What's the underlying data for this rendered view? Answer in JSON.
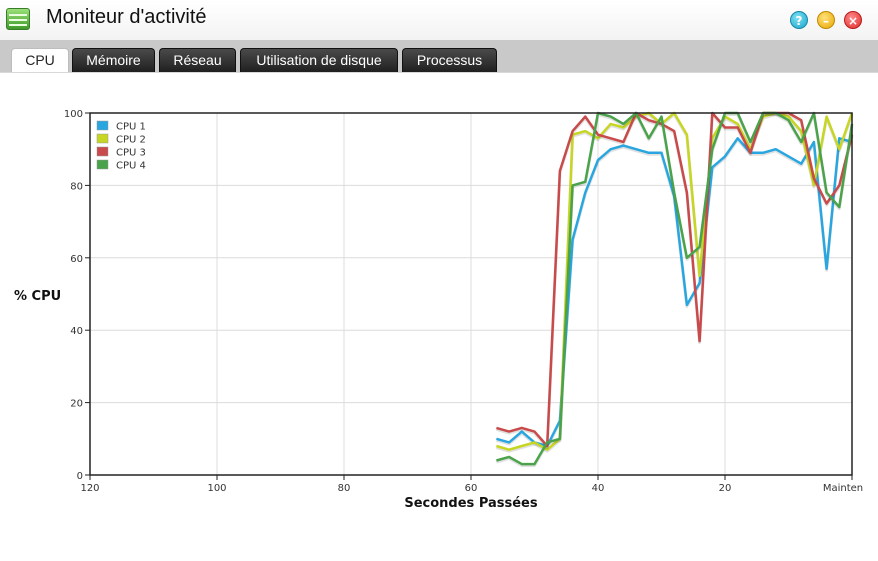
{
  "window": {
    "title": "Moniteur d'activité",
    "help_glyph": "?",
    "min_glyph": "–",
    "close_glyph": "×"
  },
  "tabs": [
    {
      "label": "CPU",
      "active": true
    },
    {
      "label": "Mémoire",
      "active": false
    },
    {
      "label": "Réseau",
      "active": false
    },
    {
      "label": "Utilisation de disque",
      "active": false
    },
    {
      "label": "Processus",
      "active": false
    }
  ],
  "colors": {
    "cpu1": "#29a6e0",
    "cpu2": "#c6d623",
    "cpu3": "#c84a4a",
    "cpu4": "#4aa34a",
    "grid": "#dcdcdc",
    "tab_dark": "#2a2a2a"
  },
  "chart_data": {
    "type": "line",
    "ylabel": "% CPU",
    "xlabel": "Secondes Passées",
    "xlim": [
      120,
      0
    ],
    "ylim": [
      0,
      100
    ],
    "x_ticks": [
      {
        "value": 120,
        "label": "120"
      },
      {
        "value": 100,
        "label": "100"
      },
      {
        "value": 80,
        "label": "80"
      },
      {
        "value": 60,
        "label": "60"
      },
      {
        "value": 40,
        "label": "40"
      },
      {
        "value": 20,
        "label": "20"
      },
      {
        "value": 0,
        "label": "Mainten"
      }
    ],
    "y_ticks": [
      {
        "value": 0,
        "label": "0"
      },
      {
        "value": 20,
        "label": "20"
      },
      {
        "value": 40,
        "label": "40"
      },
      {
        "value": 60,
        "label": "60"
      },
      {
        "value": 80,
        "label": "80"
      },
      {
        "value": 100,
        "label": "100"
      }
    ],
    "grid": true,
    "legend": "top-left",
    "x": [
      56,
      54,
      52,
      50,
      48,
      46,
      44,
      42,
      40,
      38,
      36,
      34,
      32,
      30,
      28,
      26,
      24,
      22,
      20,
      18,
      16,
      14,
      12,
      10,
      8,
      6,
      4,
      2,
      0
    ],
    "series": [
      {
        "name": "CPU 1",
        "values": [
          10,
          9,
          12,
          9,
          8,
          15,
          65,
          78,
          87,
          90,
          91,
          90,
          89,
          89,
          77,
          47,
          53,
          85,
          88,
          93,
          89,
          89,
          90,
          88,
          86,
          92,
          57,
          93,
          92
        ]
      },
      {
        "name": "CPU 2",
        "values": [
          8,
          7,
          8,
          9,
          7,
          10,
          94,
          95,
          93,
          97,
          96,
          99,
          100,
          97,
          100,
          94,
          55,
          93,
          99,
          97,
          90,
          99,
          100,
          99,
          95,
          80,
          99,
          90,
          100
        ]
      },
      {
        "name": "CPU 3",
        "values": [
          13,
          12,
          13,
          12,
          8,
          84,
          95,
          99,
          94,
          93,
          92,
          100,
          98,
          97,
          95,
          78,
          37,
          100,
          96,
          96,
          89,
          100,
          100,
          100,
          98,
          82,
          75,
          80,
          94
        ]
      },
      {
        "name": "CPU 4",
        "values": [
          4,
          5,
          3,
          3,
          9,
          10,
          80,
          81,
          100,
          99,
          97,
          100,
          93,
          99,
          78,
          60,
          63,
          90,
          100,
          100,
          92,
          100,
          100,
          98,
          92,
          100,
          78,
          74,
          97
        ]
      }
    ]
  }
}
